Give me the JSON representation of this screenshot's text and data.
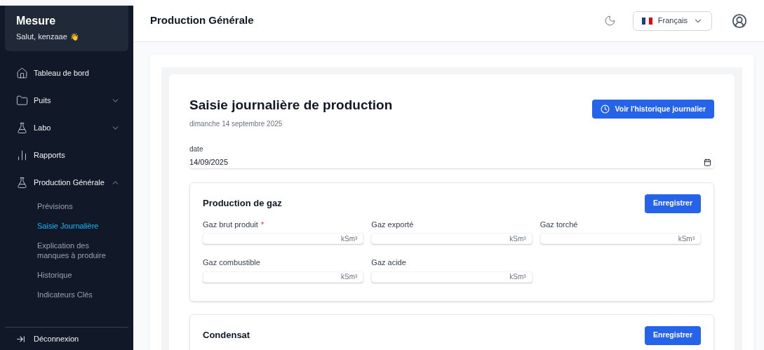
{
  "sidebar": {
    "app_name": "Mesure",
    "greeting": "Salut, kenzaae",
    "greeting_emoji": "👋",
    "items": [
      {
        "label": "Tableau de bord",
        "kind": "home"
      },
      {
        "label": "Puits",
        "kind": "folder",
        "expanded": false
      },
      {
        "label": "Labo",
        "kind": "flask",
        "expanded": false
      },
      {
        "label": "Rapports",
        "kind": "chart"
      },
      {
        "label": "Production Générale",
        "kind": "flask",
        "expanded": true,
        "children": [
          {
            "label": "Prévisions",
            "selected": false
          },
          {
            "label": "Saisie Journalière",
            "selected": true
          },
          {
            "label": "Explication des manques à produire",
            "selected": false
          },
          {
            "label": "Historique",
            "selected": false
          },
          {
            "label": "Indicateurs Clés",
            "selected": false
          }
        ]
      }
    ],
    "logout": {
      "label": "Déconnexion"
    }
  },
  "header": {
    "title": "Production Générale",
    "language": "Français"
  },
  "page": {
    "title": "Saisie journalière de production",
    "date_text": "dimanche 14 septembre 2025",
    "history_button": "Voir l'historique journalier",
    "date_field": {
      "label": "date",
      "value": "14/09/2025"
    },
    "sections": [
      {
        "title": "Production de gaz",
        "button": "Enregistrer",
        "fields": [
          {
            "label": "Gaz brut produit",
            "required": true,
            "unit": "kSm³"
          },
          {
            "label": "Gaz exporté",
            "required": false,
            "unit": "kSm³"
          },
          {
            "label": "Gaz torché",
            "required": false,
            "unit": "kSm³"
          },
          {
            "label": "Gaz combustible",
            "required": false,
            "unit": "kSm³"
          },
          {
            "label": "Gaz acide",
            "required": false,
            "unit": "kSm³"
          }
        ]
      },
      {
        "title": "Condensat",
        "button": "Enregistrer"
      }
    ],
    "required_marker": "*"
  }
}
